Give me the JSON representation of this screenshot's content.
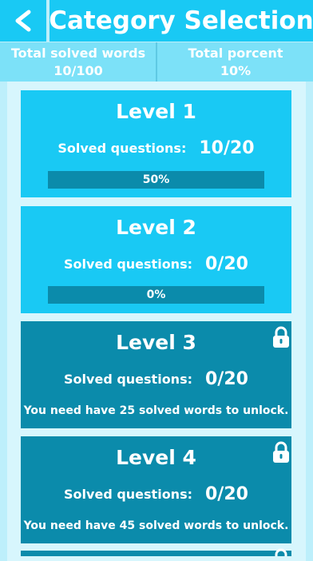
{
  "header": {
    "back_label": "<",
    "title": "Category Selection"
  },
  "stats": {
    "total_solved_label": "Total solved words",
    "total_solved_value": "10/100",
    "total_percent_label": "Total porcent",
    "total_percent_value": "10%"
  },
  "levels": [
    {
      "title": "Level 1",
      "solved_label": "Solved questions:",
      "solved_value": "10/20",
      "progress_text": "50%",
      "progress": 0.5,
      "locked": false
    },
    {
      "title": "Level 2",
      "solved_label": "Solved questions:",
      "solved_value": "0/20",
      "progress_text": "0%",
      "progress": 0.0,
      "locked": false
    },
    {
      "title": "Level 3",
      "solved_label": "Solved questions:",
      "solved_value": "0/20",
      "unlock_message": "You need have 25 solved words to unlock.",
      "locked": true
    },
    {
      "title": "Level 4",
      "solved_label": "Solved questions:",
      "solved_value": "0/20",
      "unlock_message": "You need have 45 solved words to unlock.",
      "locked": true
    }
  ],
  "colors": {
    "accent": "#19c9f4",
    "locked": "#0b8bab",
    "stats_bar": "#7ce1f8",
    "background": "#bdeffb"
  },
  "icons": {
    "back": "back-chevron-icon",
    "lock": "lock-icon"
  }
}
